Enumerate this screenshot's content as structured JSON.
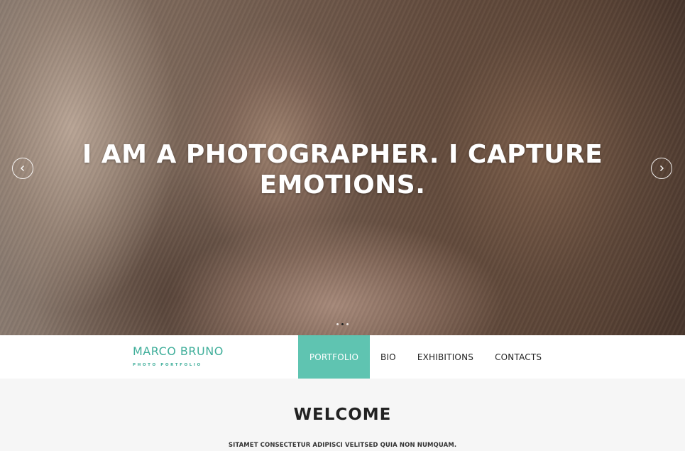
{
  "hero": {
    "title": "I AM A PHOTOGRAPHER. I CAPTURE EMOTIONS.",
    "image": "portrait-photo",
    "prev_icon": "chevron-left-icon",
    "next_icon": "chevron-right-icon",
    "slides_total": 3,
    "slide_active": 2
  },
  "brand": {
    "name": "MARCO BRUNO",
    "tagline": "PHOTO PORTFOLIO",
    "color": "#3fae9a"
  },
  "nav": {
    "items": [
      {
        "label": "PORTFOLIO",
        "active": true
      },
      {
        "label": "BIO",
        "active": false
      },
      {
        "label": "EXHIBITIONS",
        "active": false
      },
      {
        "label": "CONTACTS",
        "active": false
      }
    ],
    "active_color": "#5fc4b1"
  },
  "welcome": {
    "title": "WELCOME",
    "subtitle": "SITAMET CONSECTETUR ADIPISCI VELITSED QUIA NON NUMQUAM."
  }
}
